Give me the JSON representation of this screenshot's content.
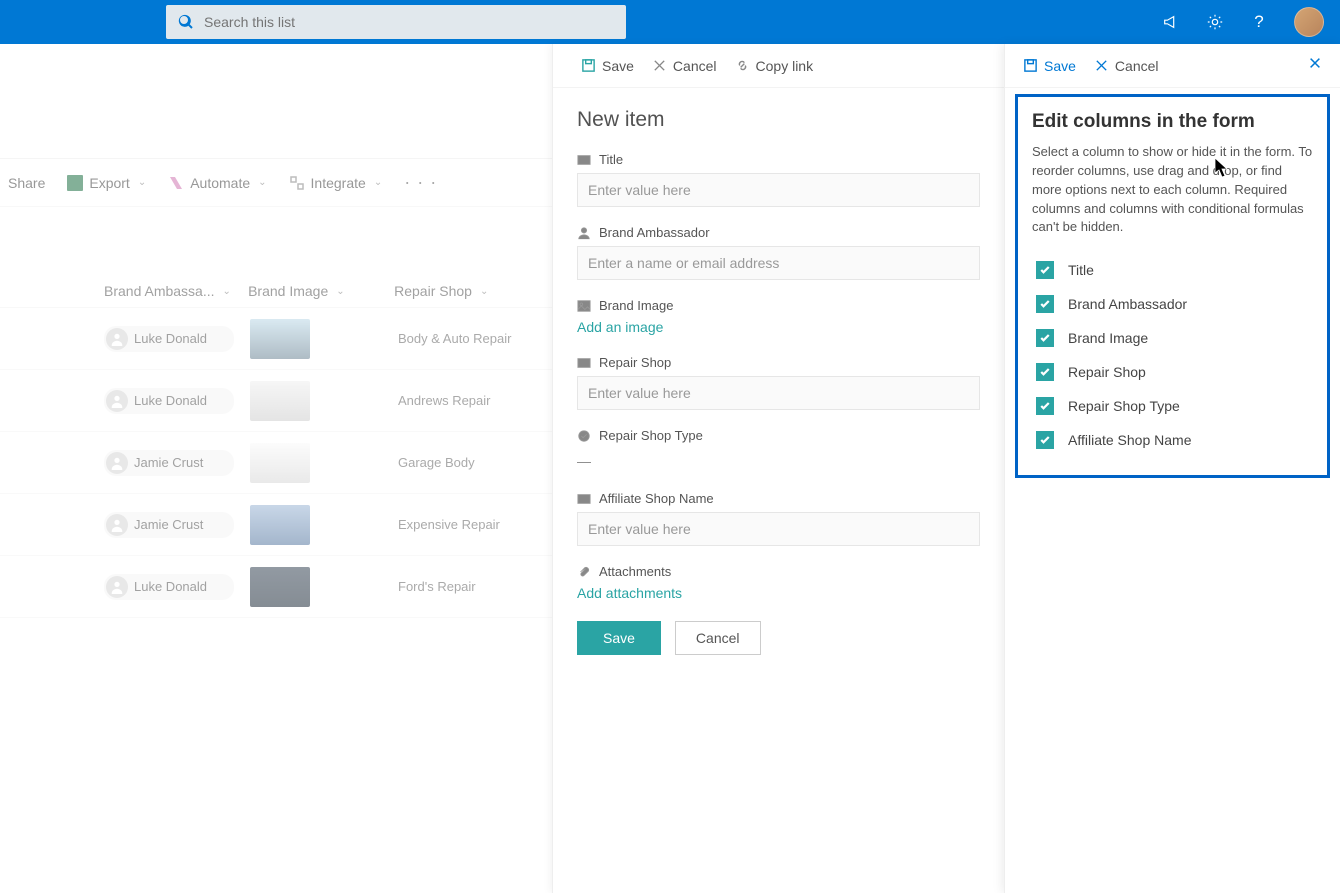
{
  "header": {
    "search_placeholder": "Search this list"
  },
  "commandbar": {
    "share": "Share",
    "export": "Export",
    "automate": "Automate",
    "integrate": "Integrate"
  },
  "table": {
    "headers": {
      "ambassador": "Brand Ambassa...",
      "image": "Brand Image",
      "shop": "Repair Shop"
    },
    "rows": [
      {
        "person": "Luke Donald",
        "car_bg": "linear-gradient(180deg,#bcd9e8,#6d8696)",
        "shop": "Body & Auto Repair"
      },
      {
        "person": "Luke Donald",
        "car_bg": "linear-gradient(180deg,#f0f0f0,#cfcfcf)",
        "shop": "Andrews Repair"
      },
      {
        "person": "Jamie Crust",
        "car_bg": "linear-gradient(180deg,#fafafa,#d8d8d8)",
        "shop": "Garage Body"
      },
      {
        "person": "Jamie Crust",
        "car_bg": "linear-gradient(180deg,#9db7d6,#5a7ba3)",
        "shop": "Expensive Repair"
      },
      {
        "person": "Luke Donald",
        "car_bg": "linear-gradient(180deg,#3a4858,#22303d)",
        "shop": "Ford's Repair"
      }
    ]
  },
  "new_panel": {
    "toolbar": {
      "save": "Save",
      "cancel": "Cancel",
      "copy": "Copy link"
    },
    "title": "New item",
    "fields": {
      "title_label": "Title",
      "title_ph": "Enter value here",
      "amb_label": "Brand Ambassador",
      "amb_ph": "Enter a name or email address",
      "img_label": "Brand Image",
      "img_link": "Add an image",
      "shop_label": "Repair Shop",
      "shop_ph": "Enter value here",
      "type_label": "Repair Shop Type",
      "type_val": "—",
      "aff_label": "Affiliate Shop Name",
      "aff_ph": "Enter value here",
      "att_label": "Attachments",
      "att_link": "Add attachments"
    },
    "save_btn": "Save",
    "cancel_btn": "Cancel"
  },
  "edit_panel": {
    "toolbar": {
      "save": "Save",
      "cancel": "Cancel"
    },
    "title": "Edit columns in the form",
    "desc": "Select a column to show or hide it in the form. To reorder columns, use drag and drop, or find more options next to each column. Required columns and columns with conditional formulas can't be hidden.",
    "items": [
      "Title",
      "Brand Ambassador",
      "Brand Image",
      "Repair Shop",
      "Repair Shop Type",
      "Affiliate Shop Name"
    ]
  }
}
